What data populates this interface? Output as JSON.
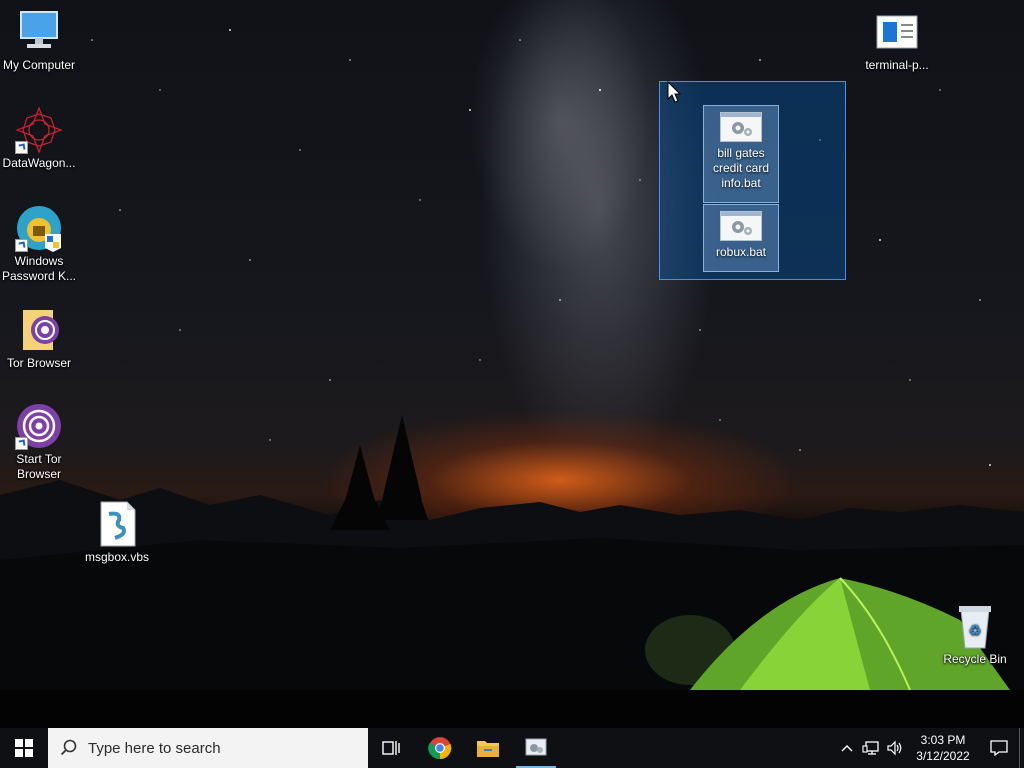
{
  "desktop": {
    "icons": [
      {
        "id": "my-computer",
        "label": "My Computer"
      },
      {
        "id": "datawagon",
        "label": "DataWagon..."
      },
      {
        "id": "windows-password",
        "label": "Windows Password K..."
      },
      {
        "id": "tor-browser-folder",
        "label": "Tor Browser"
      },
      {
        "id": "start-tor-browser",
        "label": "Start Tor Browser"
      },
      {
        "id": "msgbox-vbs",
        "label": "msgbox.vbs"
      },
      {
        "id": "terminal",
        "label": "terminal-p..."
      },
      {
        "id": "recycle-bin",
        "label": "Recycle Bin"
      }
    ],
    "selected_files": [
      {
        "id": "bill-gates-bat",
        "label": "bill gates credit card info.bat"
      },
      {
        "id": "robux-bat",
        "label": "robux.bat"
      }
    ]
  },
  "taskbar": {
    "search_placeholder": "Type here to search",
    "pinned": [
      "task-view",
      "chrome",
      "file-explorer",
      "control-panel"
    ],
    "clock": {
      "time": "3:03 PM",
      "date": "3/12/2022"
    }
  },
  "colors": {
    "taskbar": "#0f1014",
    "selection": "#0066cc",
    "active_indicator": "#76b9ed"
  }
}
